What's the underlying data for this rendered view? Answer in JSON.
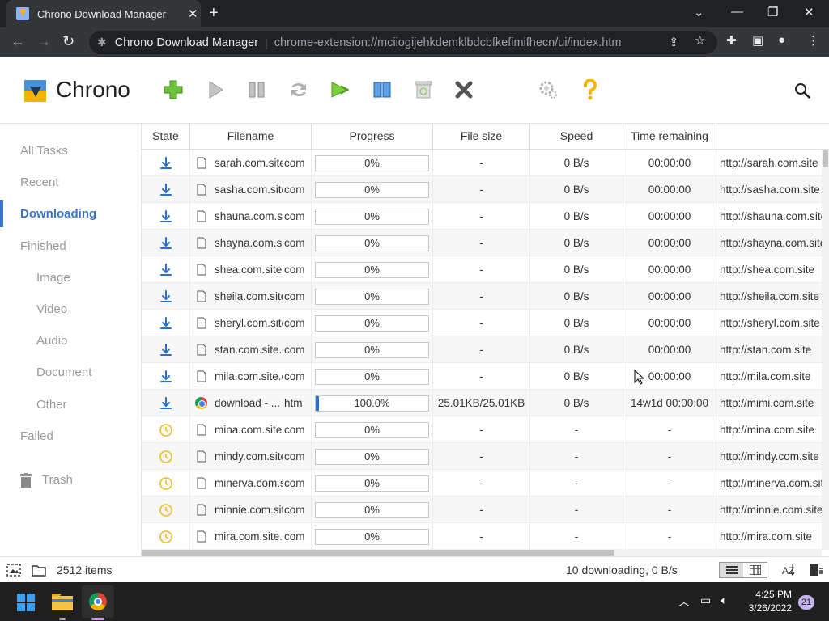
{
  "browser": {
    "tab_title": "Chrono Download Manager",
    "new_tab": "+",
    "omnibox_name": "Chrono Download Manager",
    "omnibox_url": "chrome-extension://mciiogijehkdemklbdcbfkefimifhecn/ui/index.htm"
  },
  "app": {
    "name": "Chrono",
    "brand_color": "#3a74c4"
  },
  "toolbar": [
    {
      "name": "add-icon",
      "color": "#5cb82e"
    },
    {
      "name": "play-icon",
      "color": "#a0a0a0"
    },
    {
      "name": "pause-icon",
      "color": "#a0a0a0"
    },
    {
      "name": "refresh-icon",
      "color": "#a0a0a0"
    },
    {
      "name": "resume-all-icon",
      "color": "#5cb82e"
    },
    {
      "name": "columns-icon",
      "color": "#2a6fc9"
    },
    {
      "name": "recycle-icon",
      "color": "#bdbdbd"
    },
    {
      "name": "delete-icon",
      "color": "#555555"
    },
    {
      "name": "settings-icon",
      "color": "#9a9a9a"
    },
    {
      "name": "help-icon",
      "color": "#f4b400"
    }
  ],
  "sidebar": {
    "items": [
      {
        "label": "All Tasks"
      },
      {
        "label": "Recent"
      },
      {
        "label": "Downloading"
      },
      {
        "label": "Finished"
      },
      {
        "label": "Image"
      },
      {
        "label": "Video"
      },
      {
        "label": "Audio"
      },
      {
        "label": "Document"
      },
      {
        "label": "Other"
      },
      {
        "label": "Failed"
      },
      {
        "label": "Trash"
      }
    ],
    "active": "Downloading"
  },
  "table": {
    "columns": [
      "State",
      "Filename",
      "Progress",
      "File size",
      "Speed",
      "Time remaining",
      ""
    ],
    "rows": [
      {
        "state": "downloading",
        "file_icon": "file",
        "name": "sarah.com.site.com",
        "ext": "com",
        "progress": 0,
        "progress_text": "0%",
        "size": "-",
        "speed": "0 B/s",
        "time": "00:00:00",
        "url": "http://sarah.com.site"
      },
      {
        "state": "downloading",
        "file_icon": "file",
        "name": "sasha.com.site.com",
        "ext": "com",
        "progress": 0,
        "progress_text": "0%",
        "size": "-",
        "speed": "0 B/s",
        "time": "00:00:00",
        "url": "http://sasha.com.site"
      },
      {
        "state": "downloading",
        "file_icon": "file",
        "name": "shauna.com.site.com",
        "ext": "com",
        "progress": 0,
        "progress_text": "0%",
        "size": "-",
        "speed": "0 B/s",
        "time": "00:00:00",
        "url": "http://shauna.com.site"
      },
      {
        "state": "downloading",
        "file_icon": "file",
        "name": "shayna.com.site.com",
        "ext": "com",
        "progress": 0,
        "progress_text": "0%",
        "size": "-",
        "speed": "0 B/s",
        "time": "00:00:00",
        "url": "http://shayna.com.site"
      },
      {
        "state": "downloading",
        "file_icon": "file",
        "name": "shea.com.site.com",
        "ext": "com",
        "progress": 0,
        "progress_text": "0%",
        "size": "-",
        "speed": "0 B/s",
        "time": "00:00:00",
        "url": "http://shea.com.site"
      },
      {
        "state": "downloading",
        "file_icon": "file",
        "name": "sheila.com.site.com",
        "ext": "com",
        "progress": 0,
        "progress_text": "0%",
        "size": "-",
        "speed": "0 B/s",
        "time": "00:00:00",
        "url": "http://sheila.com.site"
      },
      {
        "state": "downloading",
        "file_icon": "file",
        "name": "sheryl.com.site.com",
        "ext": "com",
        "progress": 0,
        "progress_text": "0%",
        "size": "-",
        "speed": "0 B/s",
        "time": "00:00:00",
        "url": "http://sheryl.com.site"
      },
      {
        "state": "downloading",
        "file_icon": "file",
        "name": "stan.com.site.com",
        "ext": "com",
        "progress": 0,
        "progress_text": "0%",
        "size": "-",
        "speed": "0 B/s",
        "time": "00:00:00",
        "url": "http://stan.com.site"
      },
      {
        "state": "downloading",
        "file_icon": "file",
        "name": "mila.com.site.com",
        "ext": "com",
        "progress": 0,
        "progress_text": "0%",
        "size": "-",
        "speed": "0 B/s",
        "time": "00:00:00",
        "url": "http://mila.com.site"
      },
      {
        "state": "downloading",
        "file_icon": "chrome",
        "name": "download - ...",
        "ext": "htm",
        "progress": 0.03,
        "progress_text": "100.0%",
        "size": "25.01KB/25.01KB",
        "speed": "0 B/s",
        "time": "14w1d 00:00:00",
        "url": "http://mimi.com.site"
      },
      {
        "state": "queued",
        "file_icon": "file",
        "name": "mina.com.site.com",
        "ext": "com",
        "progress": 0,
        "progress_text": "0%",
        "size": "-",
        "speed": "-",
        "time": "-",
        "url": "http://mina.com.site"
      },
      {
        "state": "queued",
        "file_icon": "file",
        "name": "mindy.com.site.com",
        "ext": "com",
        "progress": 0,
        "progress_text": "0%",
        "size": "-",
        "speed": "-",
        "time": "-",
        "url": "http://mindy.com.site"
      },
      {
        "state": "queued",
        "file_icon": "file",
        "name": "minerva.com.site.com",
        "ext": "com",
        "progress": 0,
        "progress_text": "0%",
        "size": "-",
        "speed": "-",
        "time": "-",
        "url": "http://minerva.com.site"
      },
      {
        "state": "queued",
        "file_icon": "file",
        "name": "minnie.com.site.com",
        "ext": "com",
        "progress": 0,
        "progress_text": "0%",
        "size": "-",
        "speed": "-",
        "time": "-",
        "url": "http://minnie.com.site"
      },
      {
        "state": "queued",
        "file_icon": "file",
        "name": "mira.com.site.com",
        "ext": "com",
        "progress": 0,
        "progress_text": "0%",
        "size": "-",
        "speed": "-",
        "time": "-",
        "url": "http://mira.com.site"
      }
    ]
  },
  "status": {
    "item_count": "2512 items",
    "downloading_summary": "10 downloading, 0 B/s"
  },
  "taskbar": {
    "time": "4:25 PM",
    "date": "3/26/2022",
    "notifications": "21"
  }
}
